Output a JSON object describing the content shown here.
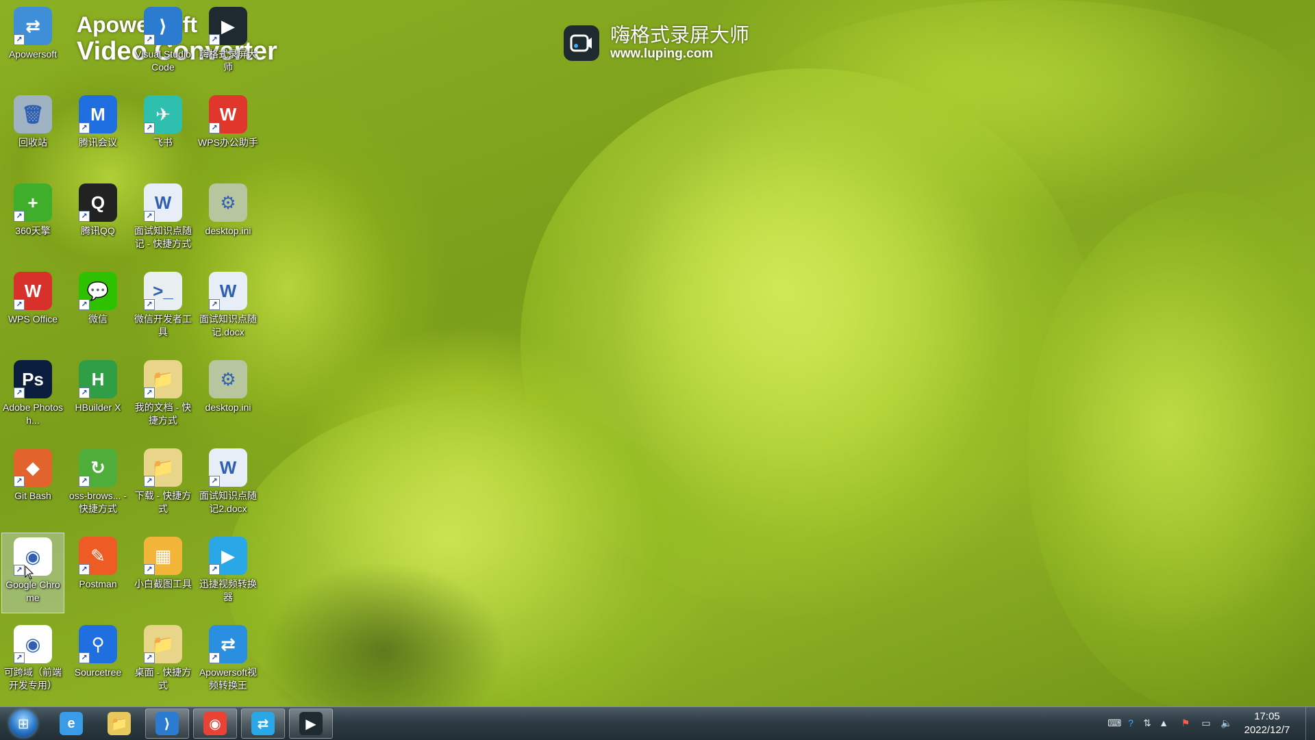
{
  "watermark": {
    "title": "嗨格式录屏大师",
    "url": "www.luping.com"
  },
  "banner": {
    "line1": "Apowersoft",
    "line2": "Video Converter"
  },
  "desktop_icons": [
    {
      "label": "Apowersoft",
      "col": 0,
      "row": 0
    },
    {
      "label": "Visual Studio Code",
      "col": 2,
      "row": 0
    },
    {
      "label": "嗨格式录屏大师",
      "col": 3,
      "row": 0
    },
    {
      "label": "回收站",
      "col": 0,
      "row": 1
    },
    {
      "label": "腾讯会议",
      "col": 1,
      "row": 1
    },
    {
      "label": "飞书",
      "col": 2,
      "row": 1
    },
    {
      "label": "WPS办公助手",
      "col": 3,
      "row": 1
    },
    {
      "label": "360天擎",
      "col": 0,
      "row": 2
    },
    {
      "label": "腾讯QQ",
      "col": 1,
      "row": 2
    },
    {
      "label": "面试知识点随记 - 快捷方式",
      "col": 2,
      "row": 2
    },
    {
      "label": "desktop.ini",
      "col": 3,
      "row": 2
    },
    {
      "label": "WPS Office",
      "col": 0,
      "row": 3
    },
    {
      "label": "微信",
      "col": 1,
      "row": 3
    },
    {
      "label": "微信开发者工具",
      "col": 2,
      "row": 3
    },
    {
      "label": "面试知识点随记.docx",
      "col": 3,
      "row": 3
    },
    {
      "label": "Adobe Photosh...",
      "col": 0,
      "row": 4
    },
    {
      "label": "HBuilder X",
      "col": 1,
      "row": 4
    },
    {
      "label": "我的文档 - 快捷方式",
      "col": 2,
      "row": 4
    },
    {
      "label": "desktop.ini",
      "col": 3,
      "row": 4
    },
    {
      "label": "Git Bash",
      "col": 0,
      "row": 5
    },
    {
      "label": "oss-brows... - 快捷方式",
      "col": 1,
      "row": 5
    },
    {
      "label": "下载 - 快捷方式",
      "col": 2,
      "row": 5
    },
    {
      "label": "面试知识点随记2.docx",
      "col": 3,
      "row": 5
    },
    {
      "label": "Google Chrome",
      "col": 0,
      "row": 6,
      "selected": true
    },
    {
      "label": "Postman",
      "col": 1,
      "row": 6
    },
    {
      "label": "小白截图工具",
      "col": 2,
      "row": 6
    },
    {
      "label": "迅捷视频转换器",
      "col": 3,
      "row": 6
    },
    {
      "label": "可跨域（前端开发专用）",
      "col": 0,
      "row": 7
    },
    {
      "label": "Sourcetree",
      "col": 1,
      "row": 7
    },
    {
      "label": "桌面 - 快捷方式",
      "col": 2,
      "row": 7
    },
    {
      "label": "Apowersoft视频转换王",
      "col": 3,
      "row": 7
    }
  ],
  "icon_styles": {
    "Apowersoft": {
      "bg": "#3f8fd8",
      "glyph": "⇄",
      "name": "apowersoft-icon"
    },
    "Visual Studio Code": {
      "bg": "#2b7bd0",
      "glyph": "⟩",
      "name": "vscode-icon"
    },
    "嗨格式录屏大师": {
      "bg": "#1e2a30",
      "glyph": "▶",
      "name": "screen-recorder-icon"
    },
    "回收站": {
      "bg": "#9fb3c2",
      "glyph": "🗑",
      "name": "recycle-bin-icon"
    },
    "腾讯会议": {
      "bg": "#1f6fe0",
      "glyph": "M",
      "name": "tencent-meeting-icon"
    },
    "飞书": {
      "bg": "#2fbfae",
      "glyph": "✈",
      "name": "feishu-icon"
    },
    "WPS办公助手": {
      "bg": "#e0362c",
      "glyph": "W",
      "name": "wps-assistant-icon"
    },
    "360天擎": {
      "bg": "#3fae2a",
      "glyph": "+",
      "name": "360-tianqing-icon"
    },
    "腾讯QQ": {
      "bg": "#222222",
      "glyph": "Q",
      "name": "qq-icon"
    },
    "面试知识点随记 - 快捷方式": {
      "bg": "#e8eef8",
      "glyph": "W",
      "name": "word-doc-shortcut-icon"
    },
    "desktop.ini": {
      "bg": "#b8c6a0",
      "glyph": "⚙",
      "name": "ini-file-icon"
    },
    "WPS Office": {
      "bg": "#d8302a",
      "glyph": "W",
      "name": "wps-office-icon"
    },
    "微信": {
      "bg": "#2dc100",
      "glyph": "💬",
      "name": "wechat-icon"
    },
    "微信开发者工具": {
      "bg": "#e9eef0",
      "glyph": ">_",
      "name": "wechat-devtools-icon"
    },
    "面试知识点随记.docx": {
      "bg": "#e8eef8",
      "glyph": "W",
      "name": "word-doc-icon"
    },
    "Adobe Photosh...": {
      "bg": "#0a1d3d",
      "glyph": "Ps",
      "name": "photoshop-icon"
    },
    "HBuilder X": {
      "bg": "#2f9e44",
      "glyph": "H",
      "name": "hbuilder-icon"
    },
    "我的文档 - 快捷方式": {
      "bg": "#e8d58a",
      "glyph": "📁",
      "name": "documents-folder-icon"
    },
    "Git Bash": {
      "bg": "#e2642c",
      "glyph": "◆",
      "name": "git-bash-icon"
    },
    "oss-brows... - 快捷方式": {
      "bg": "#4fae3a",
      "glyph": "↻",
      "name": "oss-browser-icon"
    },
    "下载 - 快捷方式": {
      "bg": "#e8d58a",
      "glyph": "📁",
      "name": "downloads-folder-icon"
    },
    "面试知识点随记2.docx": {
      "bg": "#e8eef8",
      "glyph": "W",
      "name": "word-doc-2-icon"
    },
    "Google Chrome": {
      "bg": "#ffffff",
      "glyph": "◉",
      "name": "chrome-icon"
    },
    "Postman": {
      "bg": "#ef5b25",
      "glyph": "✎",
      "name": "postman-icon"
    },
    "小白截图工具": {
      "bg": "#f3b43a",
      "glyph": "▦",
      "name": "screenshot-tool-icon"
    },
    "迅捷视频转换器": {
      "bg": "#2aa7e6",
      "glyph": "▶",
      "name": "video-converter-icon"
    },
    "可跨域（前端开发专用）": {
      "bg": "#ffffff",
      "glyph": "◉",
      "name": "chrome-cors-icon"
    },
    "Sourcetree": {
      "bg": "#1f6fe0",
      "glyph": "⚲",
      "name": "sourcetree-icon"
    },
    "桌面 - 快捷方式": {
      "bg": "#e8d58a",
      "glyph": "📁",
      "name": "desktop-folder-icon"
    },
    "Apowersoft视频转换王": {
      "bg": "#2a8fe0",
      "glyph": "⇄",
      "name": "apowersoft-converter-icon"
    }
  },
  "taskbar": {
    "apps": [
      {
        "name": "ie-icon",
        "glyph": "e",
        "color": "#3a9be8",
        "active": false
      },
      {
        "name": "file-explorer-icon",
        "glyph": "📁",
        "color": "#e8c85a",
        "active": false
      },
      {
        "name": "vscode-taskbar-icon",
        "glyph": "⟩",
        "color": "#2b7bd0",
        "active": true
      },
      {
        "name": "chrome-taskbar-icon",
        "glyph": "◉",
        "color": "#ea4335",
        "active": true
      },
      {
        "name": "apowersoft-taskbar-icon",
        "glyph": "⇄",
        "color": "#2aa7e6",
        "active": true
      },
      {
        "name": "screen-recorder-taskbar-icon",
        "glyph": "▶",
        "color": "#1e2a30",
        "active": true
      }
    ],
    "clock": {
      "time": "17:05",
      "date": "2022/12/7"
    }
  }
}
